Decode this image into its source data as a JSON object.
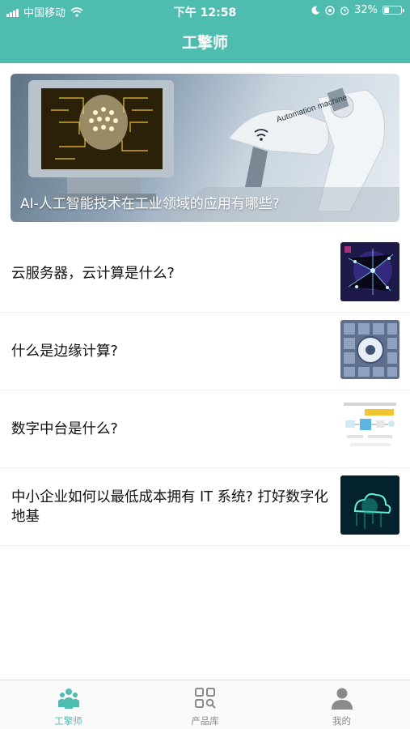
{
  "status_bar": {
    "carrier": "中国移动",
    "time": "下午 12:58",
    "battery": "32%",
    "battery_level": 0.32
  },
  "header": {
    "title": "工擎师"
  },
  "banner": {
    "caption": "AI-人工智能技术在工业领域的应用有哪些?",
    "machine_text": "Automation machine"
  },
  "articles": [
    {
      "title": "云服务器，云计算是什么?"
    },
    {
      "title": "什么是边缘计算?"
    },
    {
      "title": "数字中台是什么?"
    },
    {
      "title": "中小企业如何以最低成本拥有 IT 系统? 打好数字化地基"
    }
  ],
  "tabs": [
    {
      "label": "工擎师",
      "icon": "people-icon",
      "active": true
    },
    {
      "label": "产品库",
      "icon": "grid-search-icon",
      "active": false
    },
    {
      "label": "我的",
      "icon": "user-icon",
      "active": false
    }
  ],
  "colors": {
    "accent": "#4fbcb0",
    "inactive": "#8a8a8a"
  }
}
